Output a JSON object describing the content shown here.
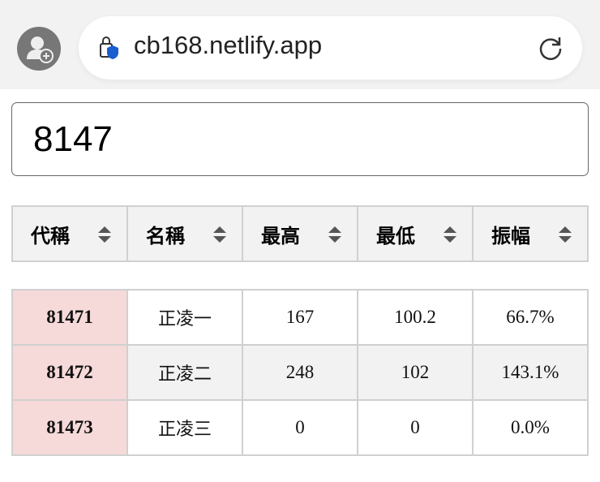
{
  "browser": {
    "url": "cb168.netlify.app"
  },
  "search": {
    "value": "8147"
  },
  "table": {
    "headers": [
      "代稱",
      "名稱",
      "最高",
      "最低",
      "振幅"
    ],
    "rows": [
      {
        "code": "81471",
        "name": "正凌一",
        "high": "167",
        "low": "100.2",
        "amp": "66.7%"
      },
      {
        "code": "81472",
        "name": "正凌二",
        "high": "248",
        "low": "102",
        "amp": "143.1%"
      },
      {
        "code": "81473",
        "name": "正凌三",
        "high": "0",
        "low": "0",
        "amp": "0.0%"
      }
    ]
  },
  "colors": {
    "code_bg": "#f6d9d9",
    "header_bg": "#f2f2f2",
    "shield": "#1a5fd0"
  }
}
